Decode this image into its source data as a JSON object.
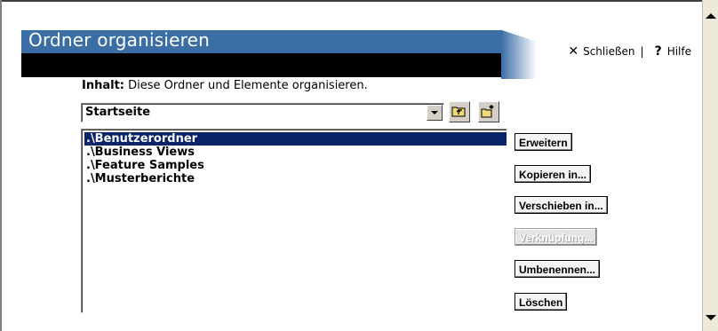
{
  "header": {
    "title": "Ordner organisieren",
    "close_label": "Schließen",
    "separator": "|",
    "help_label": "Hilfe",
    "close_icon": "x-icon",
    "help_icon": "question-icon"
  },
  "content": {
    "label_bold": "Inhalt:",
    "label_text": " Diese Ordner und Elemente organisieren."
  },
  "folder_select": {
    "selected": "Startseite",
    "up_icon": "folder-up-icon",
    "new_folder_icon": "new-folder-icon"
  },
  "items": [
    {
      "label": ".\\Benutzerordner",
      "selected": true
    },
    {
      "label": ".\\Business Views",
      "selected": false
    },
    {
      "label": ".\\Feature Samples",
      "selected": false
    },
    {
      "label": ".\\Musterberichte",
      "selected": false
    }
  ],
  "actions": {
    "expand": "Erweitern",
    "copy": "Kopieren in...",
    "move": "Verschieben in...",
    "shortcut": "Verknüpfung...",
    "rename": "Umbenennen...",
    "delete": "Löschen"
  },
  "colors": {
    "title_bar": "#3a6ea5",
    "selection": "#0a246a"
  }
}
